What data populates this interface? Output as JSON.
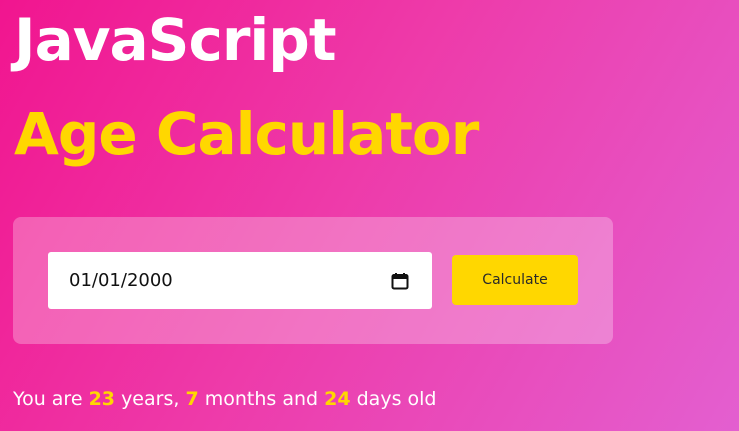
{
  "colors": {
    "accent": "#ffd700",
    "title_primary": "#ffffff",
    "background_start": "#f1158f",
    "background_end": "#e35fd0"
  },
  "header": {
    "title_line1": "JavaScript",
    "title_line2": "Age Calculator"
  },
  "form": {
    "date_value": "01/01/2000",
    "date_icon": "calendar-icon",
    "calculate_label": "Calculate"
  },
  "result": {
    "prefix": "You are",
    "years": "23",
    "years_label": "years,",
    "months": "7",
    "months_label": "months and",
    "days": "24",
    "days_label": "days old"
  }
}
